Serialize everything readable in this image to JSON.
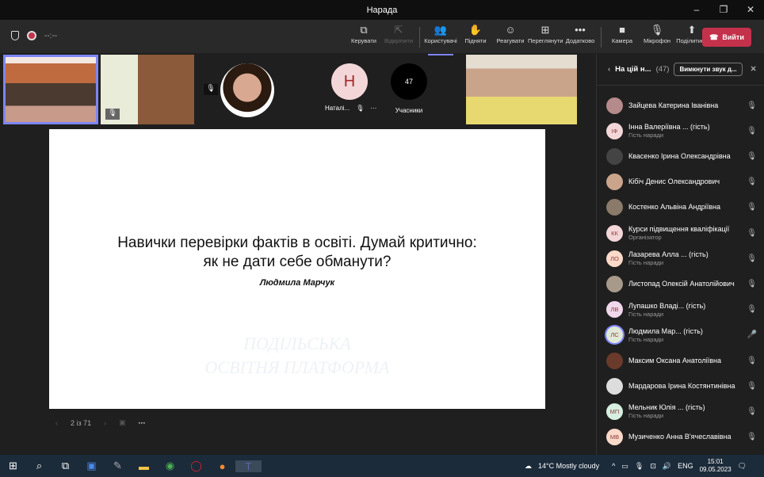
{
  "window": {
    "title": "Нарада",
    "controls": [
      "–",
      "❐",
      "✕"
    ]
  },
  "toolbar": {
    "timer": "--:--",
    "items": [
      {
        "label": "Керувати",
        "icon": "share-screen-icon",
        "glyph": "⧉",
        "state": "normal"
      },
      {
        "label": "Відкріпити",
        "icon": "pop-out-icon",
        "glyph": "⇱",
        "state": "disabled"
      },
      {
        "label": "Користувачі",
        "icon": "people-icon",
        "glyph": "👥",
        "state": "active"
      },
      {
        "label": "Підняти",
        "icon": "raise-hand-icon",
        "glyph": "✋",
        "state": "normal"
      },
      {
        "label": "Реагувати",
        "icon": "emoji-icon",
        "glyph": "☺",
        "state": "normal"
      },
      {
        "label": "Переглянути",
        "icon": "grid-view-icon",
        "glyph": "⊞",
        "state": "normal"
      },
      {
        "label": "Додатково",
        "icon": "more-icon",
        "glyph": "•••",
        "state": "normal"
      },
      {
        "label": "Камера",
        "icon": "camera-icon",
        "glyph": "■",
        "state": "normal"
      },
      {
        "label": "Мікрофон",
        "icon": "mic-off-icon",
        "glyph": "🎙",
        "state": "normal"
      },
      {
        "label": "Поділитися",
        "icon": "share-icon",
        "glyph": "⬆",
        "state": "normal"
      }
    ],
    "leave_label": "Вийти",
    "leave_color": "#c4314b"
  },
  "strip": {
    "natalia_initial": "Н",
    "natalia_name": "Наталі...",
    "count": "47",
    "count_label": "Учасники"
  },
  "slide": {
    "title_line1": "Навички перевірки фактів в освіті. Думай критично:",
    "title_line2": "як не дати себе обманути?",
    "author": "Людмила Марчук",
    "watermark_line1": "ПОДІЛЬСЬКА",
    "watermark_line2": "ОСВІТНЯ ПЛАТФОРМА",
    "page": "2 із 71"
  },
  "panel": {
    "title": "На цій н...",
    "count": "(47)",
    "mute_all": "Вимкнути звук д...",
    "participants": [
      {
        "name": "Зайцева Катерина Іванівна",
        "sub": "",
        "initials": "",
        "color": "#b58a8a",
        "mic": "off"
      },
      {
        "name": "Інна Валеріївна ... (гість)",
        "sub": "Гість наради",
        "initials": "ІФ",
        "color": "#f3d6d8",
        "mic": "off"
      },
      {
        "name": "Квасенко Ірина Олександрівна",
        "sub": "",
        "initials": "",
        "color": "#444",
        "mic": "off"
      },
      {
        "name": "Кібіч Денис Олександрович",
        "sub": "",
        "initials": "",
        "color": "#caa58c",
        "mic": "off"
      },
      {
        "name": "Костенко Альвіна Андріївна",
        "sub": "",
        "initials": "",
        "color": "#8a7a6a",
        "mic": "off"
      },
      {
        "name": "Курси підвищення кваліфікації",
        "sub": "Організатор",
        "initials": "КК",
        "color": "#f3d6d8",
        "mic": "off"
      },
      {
        "name": "Лазарева Алла ...  (гість)",
        "sub": "Гість наради",
        "initials": "ЛО",
        "color": "#fbd9c9",
        "mic": "off"
      },
      {
        "name": "Листопад Олексій Анатолійович",
        "sub": "",
        "initials": "",
        "color": "#a89a8a",
        "mic": "off"
      },
      {
        "name": "Лупашко Владі...  (гість)",
        "sub": "Гість наради",
        "initials": "ЛВ",
        "color": "#f1d7ec",
        "mic": "off"
      },
      {
        "name": "Людмила Мар...  (гість)",
        "sub": "Гість наради",
        "initials": "ЛС",
        "color": "#e0e8d8",
        "mic": "on"
      },
      {
        "name": "Максим Оксана Анатоліївна",
        "sub": "",
        "initials": "",
        "color": "#6a3a2a",
        "mic": "off"
      },
      {
        "name": "Мардарова Ірина Костянтинівна",
        "sub": "",
        "initials": "",
        "color": "#ddd",
        "mic": "off"
      },
      {
        "name": "Мельник Юлія ...  (гість)",
        "sub": "Гість наради",
        "initials": "МП",
        "color": "#d6efe0",
        "mic": "off"
      },
      {
        "name": "Музиченко Анна В'ячеславівна",
        "sub": "",
        "initials": "МВ",
        "color": "#fbd9c9",
        "mic": "off"
      }
    ]
  },
  "taskbar": {
    "weather": "14°C  Mostly cloudy",
    "lang": "ENG",
    "time": "15:01",
    "date": "09.05.2023"
  }
}
